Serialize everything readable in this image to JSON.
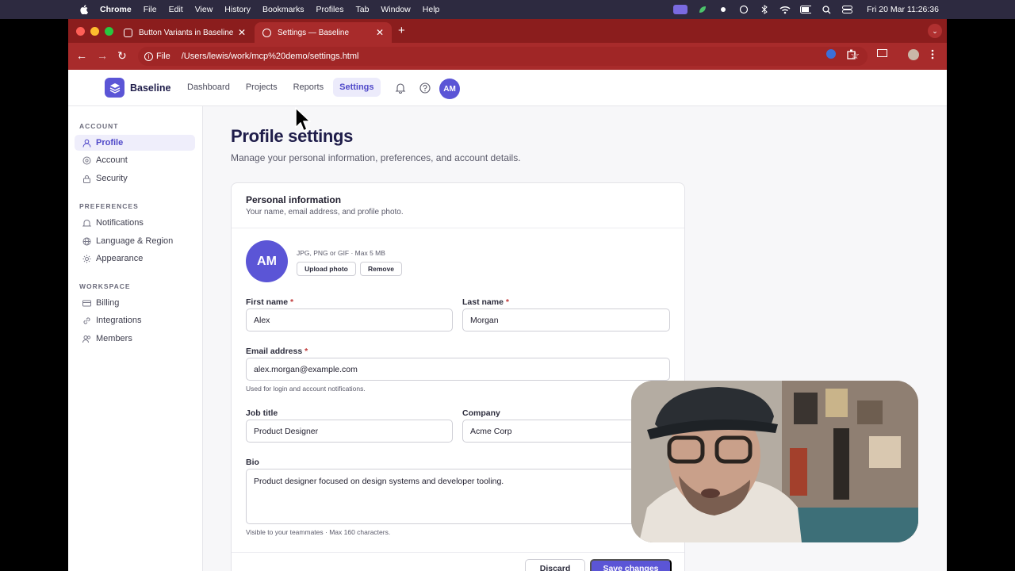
{
  "macos_menubar": {
    "app": "Chrome",
    "menus": [
      "File",
      "Edit",
      "View",
      "History",
      "Bookmarks",
      "Profiles",
      "Tab",
      "Window",
      "Help"
    ],
    "clock": "Fri 20 Mar  11:26:36"
  },
  "browser": {
    "tabs": [
      {
        "title": "Button Variants in Baseline"
      },
      {
        "title": "Settings — Baseline"
      }
    ],
    "url_scheme": "File",
    "url": "/Users/lewis/work/mcp%20demo/settings.html"
  },
  "app_header": {
    "brand": "Baseline",
    "nav": [
      "Dashboard",
      "Projects",
      "Reports",
      "Settings"
    ],
    "user_initials": "AM"
  },
  "sidebar": {
    "account_heading": "ACCOUNT",
    "account_items": [
      "Profile",
      "Account",
      "Security"
    ],
    "preferences_heading": "PREFERENCES",
    "preferences_items": [
      "Notifications",
      "Language & Region",
      "Appearance"
    ],
    "workspace_heading": "WORKSPACE",
    "workspace_items": [
      "Billing",
      "Integrations",
      "Members"
    ]
  },
  "main": {
    "title": "Profile settings",
    "subtitle": "Manage your personal information, preferences, and account details."
  },
  "card": {
    "title": "Personal information",
    "subtitle": "Your name, email address, and profile photo.",
    "avatar_initials": "AM",
    "photo_hint": "JPG, PNG or GIF · Max 5 MB",
    "upload_label": "Upload photo",
    "remove_label": "Remove",
    "first_name_label": "First name",
    "first_name_value": "Alex",
    "last_name_label": "Last name",
    "last_name_value": "Morgan",
    "email_label": "Email address",
    "email_value": "alex.morgan@example.com",
    "email_help": "Used for login and account notifications.",
    "job_label": "Job title",
    "job_value": "Product Designer",
    "company_label": "Company",
    "company_value": "Acme Corp",
    "bio_label": "Bio",
    "bio_value": "Product designer focused on design systems and developer tooling.",
    "bio_help": "Visible to your teammates · Max 160 characters.",
    "required_mark": "*",
    "discard_label": "Discard",
    "save_label": "Save changes"
  },
  "colors": {
    "accent": "#5b55d6",
    "browser_frame": "#a82b2b",
    "heading": "#1f1d4a"
  }
}
